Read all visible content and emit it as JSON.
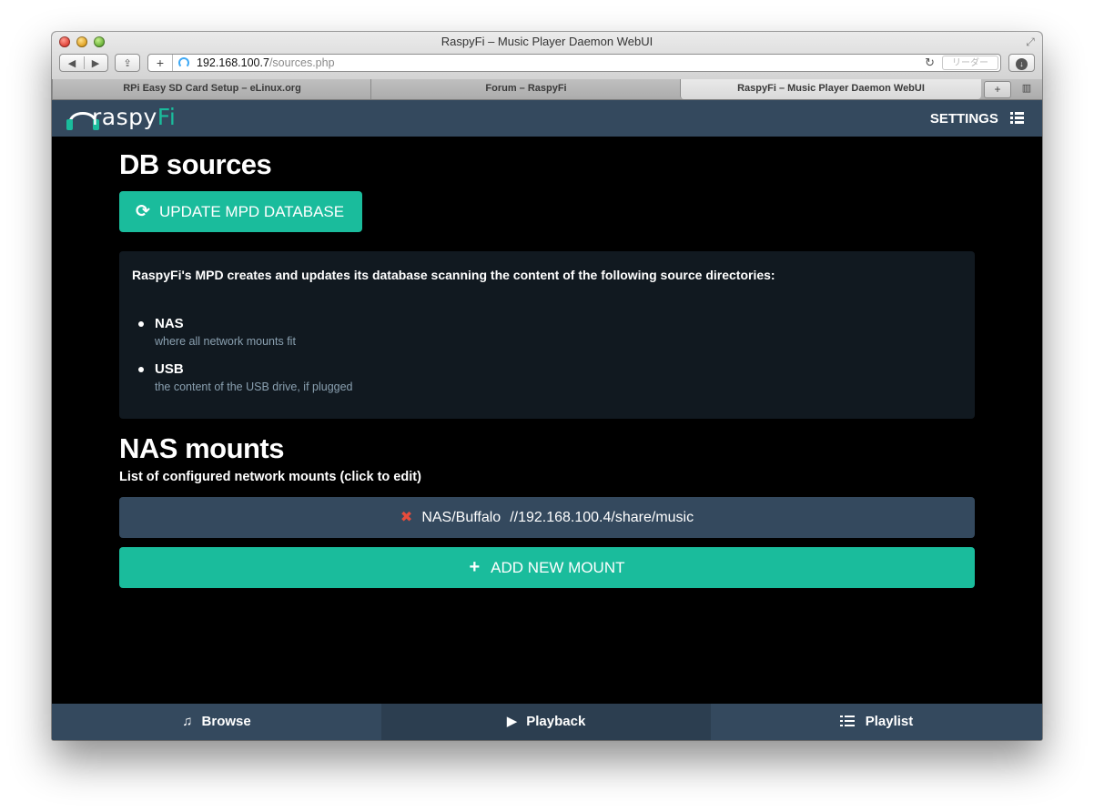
{
  "browser": {
    "window_title": "RaspyFi – Music Player Daemon WebUI",
    "address_host": "192.168.100.7",
    "address_path": "/sources.php",
    "reader_label": "リーダー",
    "tabs": [
      {
        "label": "RPi Easy SD Card Setup – eLinux.org"
      },
      {
        "label": "Forum – RaspyFi"
      },
      {
        "label": "RaspyFi – Music Player Daemon WebUI"
      }
    ]
  },
  "header": {
    "logo_text_main": "raspy",
    "logo_text_accent": "Fi",
    "settings_label": "SETTINGS"
  },
  "main": {
    "db_title": "DB sources",
    "update_button": "UPDATE MPD DATABASE",
    "info_intro": "RaspyFi's MPD creates and updates its database scanning the content of the following source directories:",
    "sources": [
      {
        "name": "NAS",
        "description": "where all network mounts fit"
      },
      {
        "name": "USB",
        "description": "the content of the USB drive, if plugged"
      }
    ],
    "nas_title": "NAS mounts",
    "nas_subtitle": "List of configured network mounts (click to edit)",
    "mounts": [
      {
        "name": "NAS/Buffalo",
        "path": "//192.168.100.4/share/music"
      }
    ],
    "add_button": "ADD NEW MOUNT"
  },
  "footer": {
    "tabs": [
      {
        "label": "Browse",
        "icon": "music-note-icon"
      },
      {
        "label": "Playback",
        "icon": "play-icon"
      },
      {
        "label": "Playlist",
        "icon": "list-icon"
      }
    ],
    "active": "Playback"
  },
  "colors": {
    "accent": "#1abc9c",
    "header_bg": "#34495e",
    "delete": "#e74c3c"
  }
}
